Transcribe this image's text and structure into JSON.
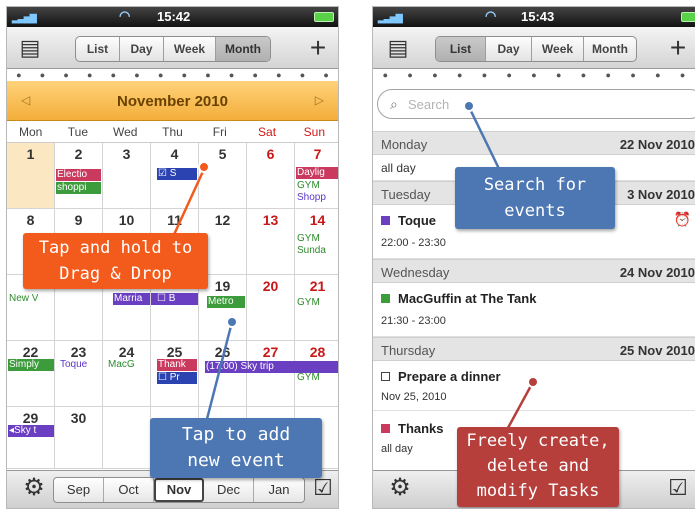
{
  "left_phone": {
    "status": {
      "time": "15:42"
    },
    "toolbar": {
      "tabs": [
        "List",
        "Day",
        "Week",
        "Month"
      ],
      "active": "Month",
      "add": "+"
    },
    "month_title": "November 2010",
    "weekdays": [
      "Mon",
      "Tue",
      "Wed",
      "Thu",
      "Fri",
      "Sat",
      "Sun"
    ],
    "days": {
      "d1": "1",
      "d2": "2",
      "d3": "3",
      "d4": "4",
      "d5": "5",
      "d6": "6",
      "d7": "7",
      "d8": "8",
      "d9": "9",
      "d10": "10",
      "d11": "11",
      "d12": "12",
      "d13": "13",
      "d14": "14",
      "d19": "19",
      "d20": "20",
      "d21": "21",
      "d22": "22",
      "d23": "23",
      "d24": "24",
      "d25": "25",
      "d26": "26",
      "d27": "27",
      "d28": "28",
      "d29": "29",
      "d30": "30"
    },
    "events": {
      "electio": "Electio",
      "shoppi": "shoppi",
      "daylig": "Daylig",
      "gym7": "GYM",
      "shopp": "Shopp",
      "s4": "S",
      "gym14": "GYM",
      "sunda": "Sunda",
      "newv": "New V",
      "marria": "Marria",
      "b19": "B",
      "metro": "Metro",
      "gym21": "GYM",
      "simply": "Simply",
      "toque": "Toque",
      "macg": "MacG",
      "thank": "Thank",
      "pr": "Pr",
      "skytrip": "(17:00) Sky trip",
      "gym28": "GYM",
      "skyt": "◂Sky t",
      "ym": "YM"
    },
    "callouts": {
      "drag": "Tap and hold to\nDrag & Drop",
      "add": "Tap to add\nnew event"
    },
    "bottom": {
      "months": [
        "Sep",
        "Oct",
        "Nov",
        "Dec",
        "Jan"
      ],
      "active": "Nov"
    }
  },
  "right_phone": {
    "status": {
      "time": "15:43"
    },
    "toolbar": {
      "tabs": [
        "List",
        "Day",
        "Week",
        "Month"
      ],
      "active": "List",
      "add": "+"
    },
    "search_placeholder": "Search",
    "sections": [
      {
        "day": "Monday",
        "date": "22 Nov 2010"
      },
      {
        "day": "Tuesday",
        "date": "3 Nov 2010"
      },
      {
        "day": "Wednesday",
        "date": "24 Nov 2010"
      },
      {
        "day": "Thursday",
        "date": "25 Nov 2010"
      }
    ],
    "items": {
      "allday1": "all day",
      "toque_title": "Toque",
      "toque_time": "22:00 - 23:30",
      "macguffin_title": "MacGuffin at The Tank",
      "macguffin_time": "21:30 - 23:00",
      "dinner_title": "Prepare a dinner",
      "dinner_date": "Nov 25, 2010",
      "thanks_title": "Thanks",
      "allday2": "all day"
    },
    "callouts": {
      "search": "Search for\nevents",
      "tasks": "Freely create,\ndelete and\nmodify Tasks"
    }
  },
  "colors": {
    "orange_callout": "#f35b1d",
    "blue_callout": "#4c77b3",
    "red_callout": "#b63f3c",
    "month_bar": "#f3ae3a"
  }
}
